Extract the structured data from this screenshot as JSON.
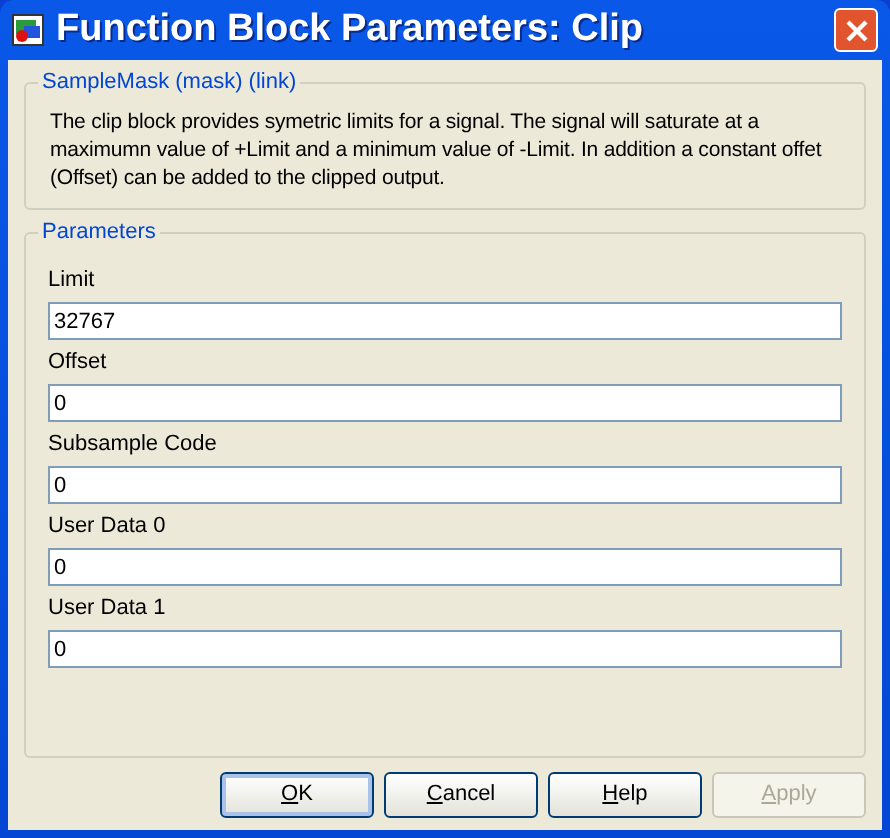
{
  "window": {
    "title": "Function Block Parameters: Clip"
  },
  "description_group": {
    "title": "SampleMask (mask) (link)",
    "text": "The clip block provides symetric limits for a signal. The signal will saturate at a maximumn value of +Limit and a minimum value of -Limit. In addition a constant offet (Offset) can be added to the clipped output."
  },
  "parameters_group": {
    "title": "Parameters",
    "fields": [
      {
        "label": "Limit",
        "value": "32767"
      },
      {
        "label": "Offset",
        "value": "0"
      },
      {
        "label": "Subsample Code",
        "value": "0"
      },
      {
        "label": "User Data 0",
        "value": "0"
      },
      {
        "label": "User Data 1",
        "value": "0"
      }
    ]
  },
  "buttons": [
    {
      "key": "O",
      "rest": "K",
      "default": true,
      "disabled": false
    },
    {
      "key": "C",
      "rest": "ancel",
      "default": false,
      "disabled": false
    },
    {
      "key": "H",
      "rest": "elp",
      "default": false,
      "disabled": false
    },
    {
      "key": "A",
      "rest": "pply",
      "default": false,
      "disabled": true
    }
  ]
}
